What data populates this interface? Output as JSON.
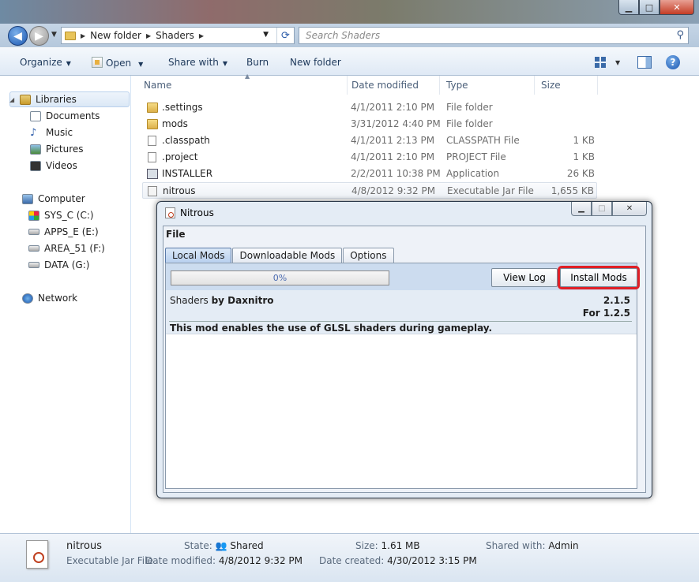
{
  "explorer": {
    "address": {
      "crumb1": "New folder",
      "crumb2": "Shaders"
    },
    "search_placeholder": "Search Shaders",
    "toolbar": {
      "organize": "Organize",
      "open": "Open",
      "share_with": "Share with",
      "burn": "Burn",
      "new_folder": "New folder"
    },
    "columns": {
      "name": "Name",
      "date": "Date modified",
      "type": "Type",
      "size": "Size"
    },
    "nav": {
      "libraries": "Libraries",
      "documents": "Documents",
      "music": "Music",
      "pictures": "Pictures",
      "videos": "Videos",
      "computer": "Computer",
      "drive_c": "SYS_C (C:)",
      "drive_e": "APPS_E (E:)",
      "drive_f": "AREA_51 (F:)",
      "drive_g": "DATA (G:)",
      "network": "Network"
    },
    "files": [
      {
        "name": ".settings",
        "date": "4/1/2011 2:10 PM",
        "type": "File folder",
        "size": "",
        "icon": "folder-icon"
      },
      {
        "name": "mods",
        "date": "3/31/2012 4:40 PM",
        "type": "File folder",
        "size": "",
        "icon": "folder-icon"
      },
      {
        "name": ".classpath",
        "date": "4/1/2011 2:13 PM",
        "type": "CLASSPATH File",
        "size": "1 KB",
        "icon": "file-icon"
      },
      {
        "name": ".project",
        "date": "4/1/2011 2:10 PM",
        "type": "PROJECT File",
        "size": "1 KB",
        "icon": "file-icon"
      },
      {
        "name": "INSTALLER",
        "date": "2/2/2011 10:38 PM",
        "type": "Application",
        "size": "26 KB",
        "icon": "application-icon"
      },
      {
        "name": "nitrous",
        "date": "4/8/2012 9:32 PM",
        "type": "Executable Jar File",
        "size": "1,655 KB",
        "icon": "jar-file-icon"
      }
    ],
    "details": {
      "name": "nitrous",
      "type": "Executable Jar File",
      "state_label": "State:",
      "state_value": "Shared",
      "modified_label": "Date modified:",
      "modified_value": "4/8/2012 9:32 PM",
      "size_label": "Size:",
      "size_value": "1.61 MB",
      "created_label": "Date created:",
      "created_value": "4/30/2012 3:15 PM",
      "shared_label": "Shared with:",
      "shared_value": "Admin"
    }
  },
  "nitrous": {
    "title": "Nitrous",
    "menu_file": "File",
    "tabs": [
      "Local Mods",
      "Downloadable Mods",
      "Options"
    ],
    "progress_text": "0%",
    "progress_value": 0,
    "view_log": "View Log",
    "install_mods": "Install Mods",
    "mod": {
      "name": "Shaders",
      "by": "by Daxnitro",
      "version": "2.1.5",
      "for": "For 1.2.5",
      "description": "This mod enables the use of GLSL shaders during gameplay."
    }
  },
  "colors": {
    "highlight": "#e01f26",
    "link_blue": "#1e395b"
  }
}
